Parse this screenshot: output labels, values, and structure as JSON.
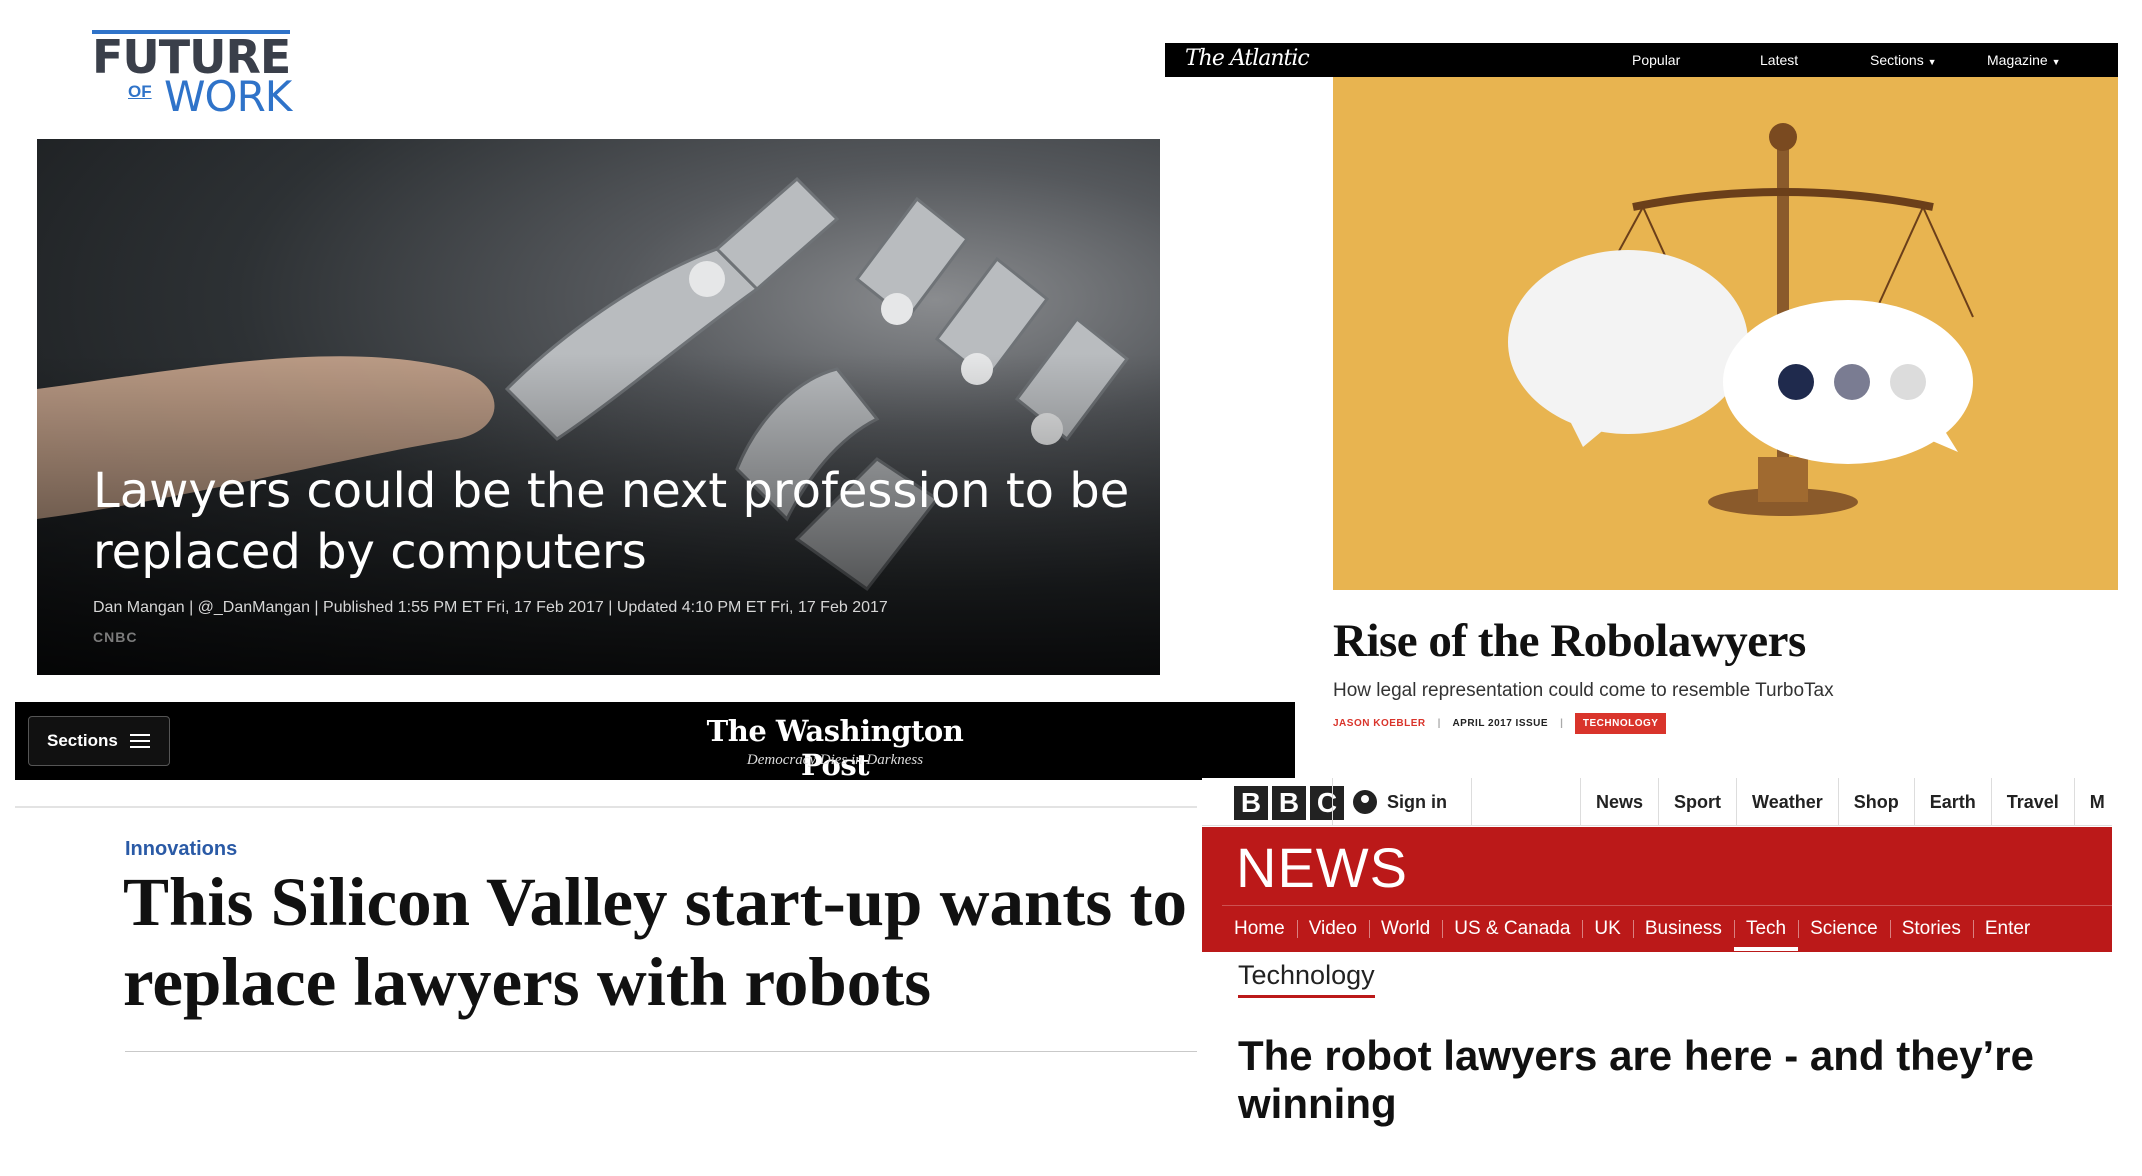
{
  "future_of_work": {
    "logo_top": "FUTURE",
    "logo_of": "OF",
    "logo_work": "WORK"
  },
  "cnbc": {
    "headline": "Lawyers could be the next profession to be replaced by computers",
    "byline": "Dan Mangan | @_DanMangan | Published 1:55 PM ET Fri, 17 Feb 2017 | Updated 4:10 PM ET Fri, 17 Feb 2017",
    "brand": "CNBC"
  },
  "wapo": {
    "sections_label": "Sections",
    "title": "The Washington Post",
    "tagline": "Democracy Dies in Darkness",
    "kicker": "Innovations",
    "headline": "This Silicon Valley start-up wants to replace lawyers with robots"
  },
  "atlantic": {
    "logo": "The Atlantic",
    "nav": [
      "Popular",
      "Latest",
      "Sections",
      "Magazine"
    ],
    "headline": "Rise of the Robolawyers",
    "dek": "How legal representation could come to resemble TurboTax",
    "author": "JASON KOEBLER",
    "issue": "APRIL 2017 ISSUE",
    "badge": "TECHNOLOGY",
    "colors": {
      "hero_bg": "#e8b450",
      "accent": "#d9342b"
    }
  },
  "bbc": {
    "blocks": [
      "B",
      "B",
      "C"
    ],
    "sign_in": "Sign in",
    "top_nav": [
      "News",
      "Sport",
      "Weather",
      "Shop",
      "Earth",
      "Travel",
      "M"
    ],
    "news_wordmark": "NEWS",
    "sub_nav": [
      "Home",
      "Video",
      "World",
      "US & Canada",
      "UK",
      "Business",
      "Tech",
      "Science",
      "Stories",
      "Enter"
    ],
    "active_sub_nav": "Tech",
    "section": "Technology",
    "headline": "The robot lawyers are here - and they’re winning",
    "colors": {
      "red": "#bb1919"
    }
  }
}
